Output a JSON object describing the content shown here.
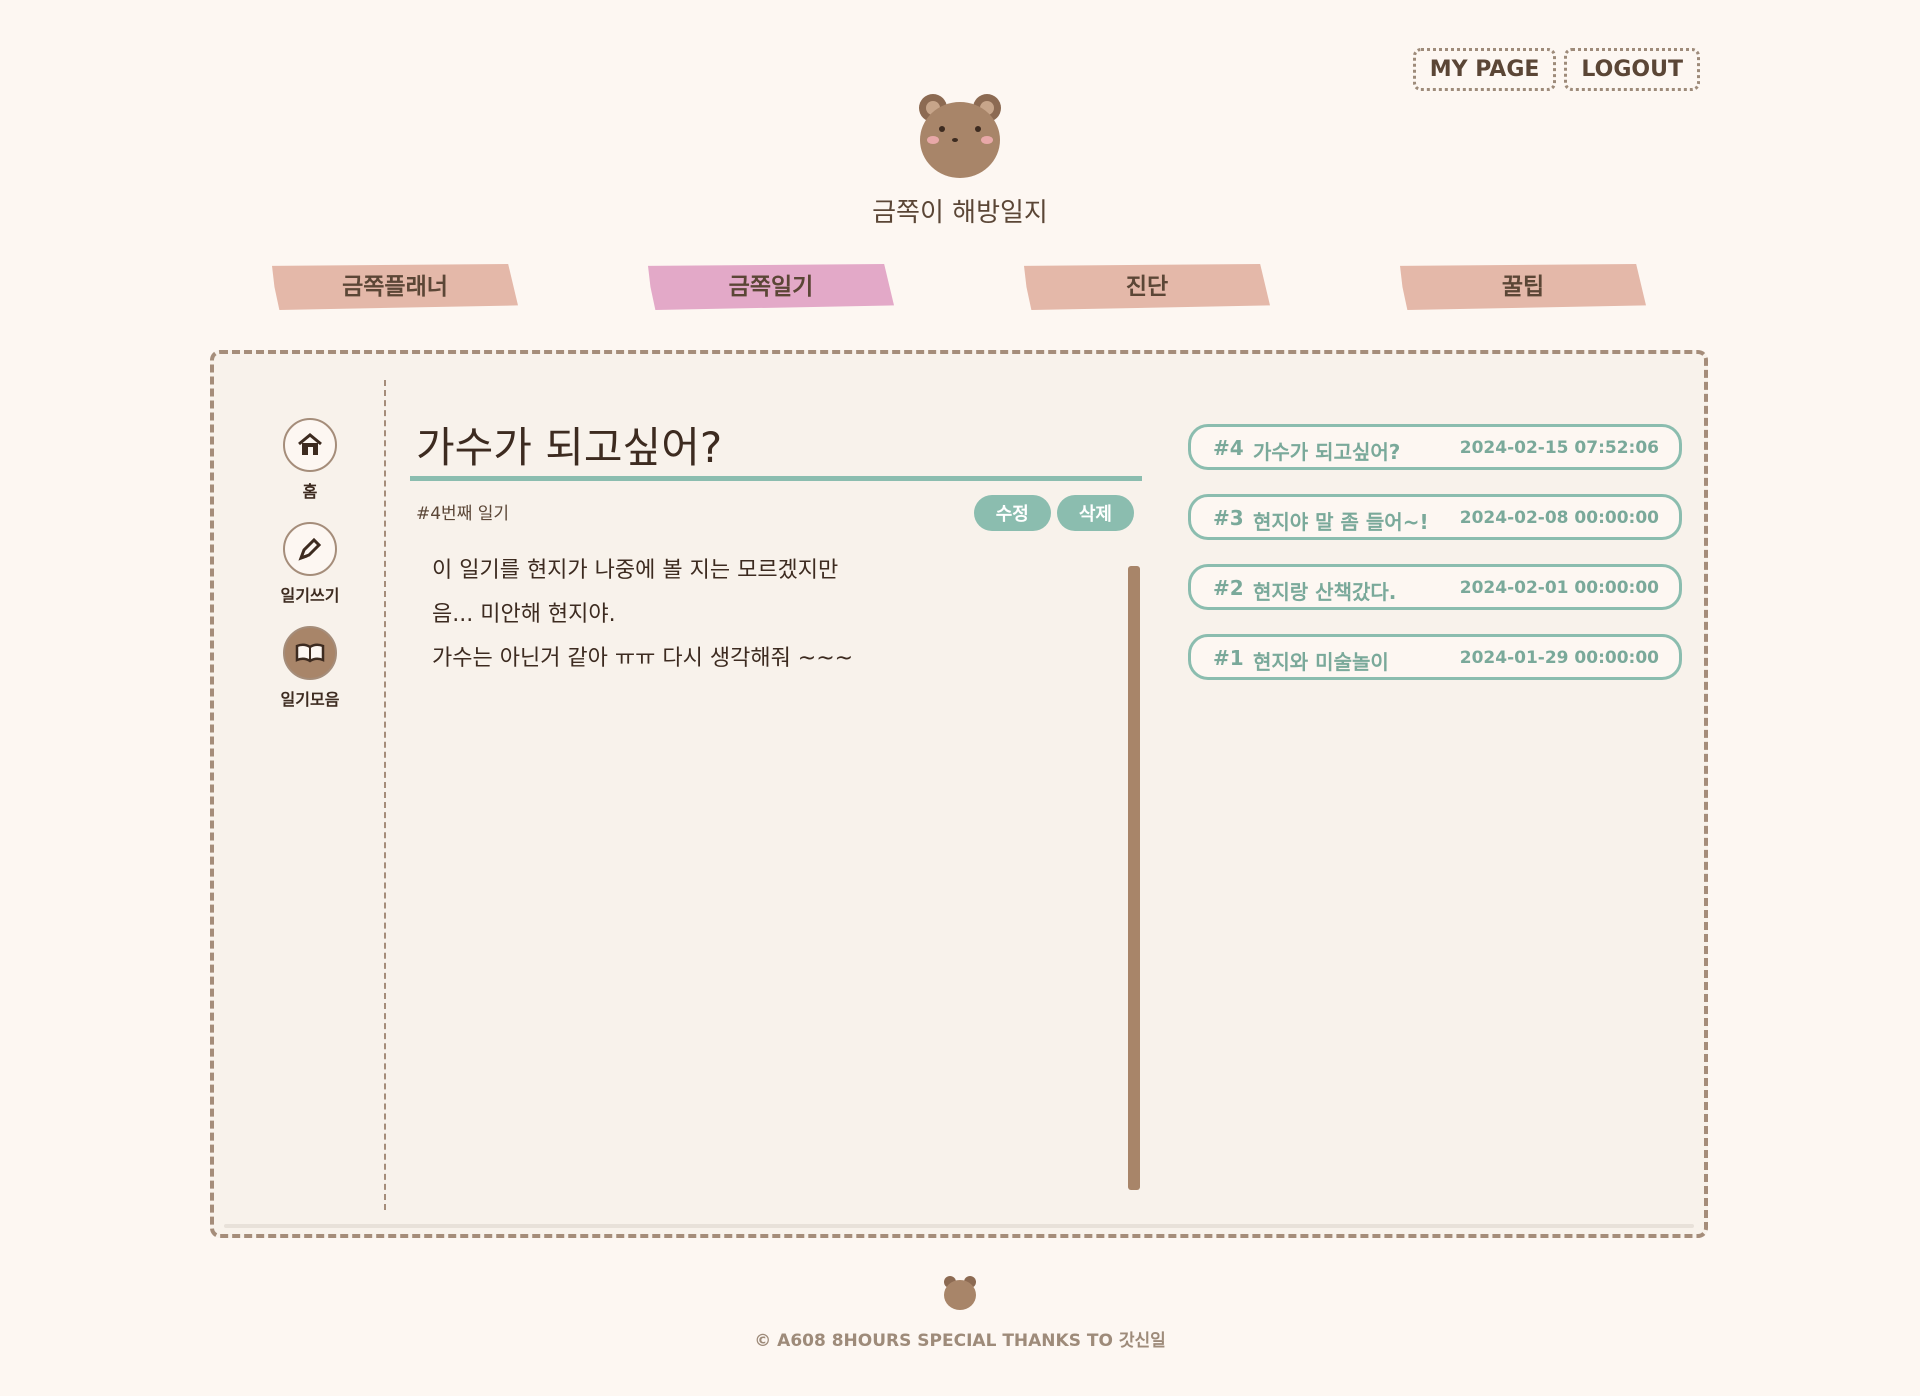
{
  "header": {
    "links": [
      "MY PAGE",
      "LOGOUT"
    ],
    "logo_text": "금쪽이 해방일지"
  },
  "nav": {
    "items": [
      "금쪽플래너",
      "금쪽일기",
      "진단",
      "꿀팁"
    ],
    "active": "금쪽일기"
  },
  "sidebar": {
    "items": [
      {
        "label": "홈",
        "icon": "home-icon"
      },
      {
        "label": "일기쓰기",
        "icon": "pencil-icon"
      },
      {
        "label": "일기모음",
        "icon": "book-icon"
      }
    ]
  },
  "diary": {
    "title": "가수가 되고싶어?",
    "number_label": "#4번째 일기",
    "edit_label": "수정",
    "delete_label": "삭제",
    "lines": [
      "이 일기를 현지가 나중에 볼 지는 모르겠지만",
      "음... 미안해 현지야.",
      "가수는 아닌거 같아 ㅠㅠ 다시 생각해줘 ~~~"
    ]
  },
  "diary_list": [
    {
      "num": "#4",
      "title": "가수가 되고싶어?",
      "date": "2024-02-15 07:52:06"
    },
    {
      "num": "#3",
      "title": "현지야 말 좀 들어~!",
      "date": "2024-02-08 00:00:00"
    },
    {
      "num": "#2",
      "title": "현지랑 산책갔다.",
      "date": "2024-02-01 00:00:00"
    },
    {
      "num": "#1",
      "title": "현지와 미술놀이",
      "date": "2024-01-29 00:00:00"
    }
  ],
  "footer": {
    "text": "© A608 8HOURS SPECIAL THANKS TO 갓신일"
  },
  "colors": {
    "background": "#fdf7f2",
    "accent_teal": "#8bbdaf",
    "nav_tab": "#e4b8a9",
    "nav_tab_active": "#e3a9c8",
    "brown": "#a88569"
  }
}
